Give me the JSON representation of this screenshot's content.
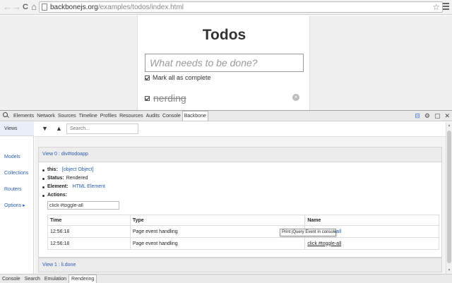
{
  "browser": {
    "back_icon": "←",
    "forward_icon": "→",
    "reload_icon": "C",
    "home_icon": "⌂",
    "url_host": "backbonejs.org",
    "url_path": "/examples/todos/index.html",
    "star_icon": "☆"
  },
  "todo_app": {
    "title": "Todos",
    "new_todo_placeholder": "What needs to be done?",
    "mark_all_label": "Mark all as complete",
    "items": [
      {
        "label": "nerding",
        "completed": true
      }
    ],
    "destroy_icon": "×"
  },
  "devtools": {
    "tabs": [
      "Elements",
      "Network",
      "Sources",
      "Timeline",
      "Profiles",
      "Resources",
      "Audits",
      "Console",
      "Backbone"
    ],
    "active_tab": "Backbone",
    "right_icons": {
      "split": "⊟",
      "settings": "⚙",
      "dock": "▢",
      "close": "✕"
    },
    "sidebar": {
      "items": [
        "Views",
        "Models",
        "Collections",
        "Routers",
        "Options ▸"
      ],
      "active": "Views"
    },
    "toolbar": {
      "down_icon": "▼",
      "up_icon": "▲",
      "search_placeholder": "Search..."
    },
    "view": {
      "header": "View 0 : div#todoapp",
      "props": {
        "this_label": "this:",
        "this_value": "[object Object]",
        "status_label": "Status:",
        "status_value": "Rendered",
        "element_label": "Element:",
        "element_value": "HTML Element",
        "actions_label": "Actions:"
      },
      "action_filter": "click #toggle-all",
      "table": {
        "headers": [
          "Time",
          "Type",
          "Name"
        ],
        "rows": [
          {
            "time": "12:56:18",
            "type": "Page event handling",
            "name": "click #toggle-all"
          },
          {
            "time": "12:56:18",
            "type": "Page event handling",
            "name": "click #toggle-all"
          }
        ]
      },
      "tooltip": "Print jQuery Event in console",
      "footer": "View 1 : li.done"
    },
    "drawer_tabs": [
      "Console",
      "Search",
      "Emulation",
      "Rendering"
    ],
    "drawer_active": "Rendering"
  }
}
